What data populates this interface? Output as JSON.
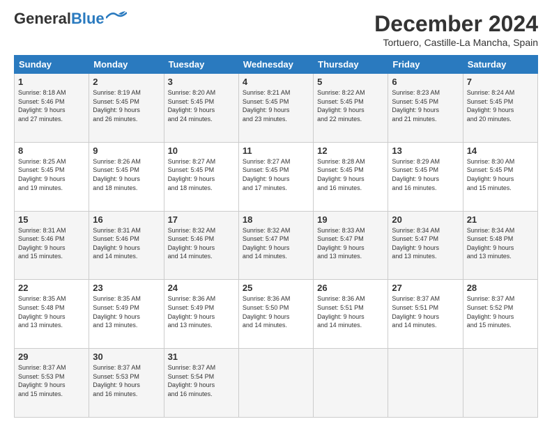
{
  "header": {
    "logo_line1": "General",
    "logo_line2": "Blue",
    "month": "December 2024",
    "location": "Tortuero, Castille-La Mancha, Spain"
  },
  "weekdays": [
    "Sunday",
    "Monday",
    "Tuesday",
    "Wednesday",
    "Thursday",
    "Friday",
    "Saturday"
  ],
  "weeks": [
    [
      {
        "day": "1",
        "info": "Sunrise: 8:18 AM\nSunset: 5:46 PM\nDaylight: 9 hours\nand 27 minutes."
      },
      {
        "day": "2",
        "info": "Sunrise: 8:19 AM\nSunset: 5:45 PM\nDaylight: 9 hours\nand 26 minutes."
      },
      {
        "day": "3",
        "info": "Sunrise: 8:20 AM\nSunset: 5:45 PM\nDaylight: 9 hours\nand 24 minutes."
      },
      {
        "day": "4",
        "info": "Sunrise: 8:21 AM\nSunset: 5:45 PM\nDaylight: 9 hours\nand 23 minutes."
      },
      {
        "day": "5",
        "info": "Sunrise: 8:22 AM\nSunset: 5:45 PM\nDaylight: 9 hours\nand 22 minutes."
      },
      {
        "day": "6",
        "info": "Sunrise: 8:23 AM\nSunset: 5:45 PM\nDaylight: 9 hours\nand 21 minutes."
      },
      {
        "day": "7",
        "info": "Sunrise: 8:24 AM\nSunset: 5:45 PM\nDaylight: 9 hours\nand 20 minutes."
      }
    ],
    [
      {
        "day": "8",
        "info": "Sunrise: 8:25 AM\nSunset: 5:45 PM\nDaylight: 9 hours\nand 19 minutes."
      },
      {
        "day": "9",
        "info": "Sunrise: 8:26 AM\nSunset: 5:45 PM\nDaylight: 9 hours\nand 18 minutes."
      },
      {
        "day": "10",
        "info": "Sunrise: 8:27 AM\nSunset: 5:45 PM\nDaylight: 9 hours\nand 18 minutes."
      },
      {
        "day": "11",
        "info": "Sunrise: 8:27 AM\nSunset: 5:45 PM\nDaylight: 9 hours\nand 17 minutes."
      },
      {
        "day": "12",
        "info": "Sunrise: 8:28 AM\nSunset: 5:45 PM\nDaylight: 9 hours\nand 16 minutes."
      },
      {
        "day": "13",
        "info": "Sunrise: 8:29 AM\nSunset: 5:45 PM\nDaylight: 9 hours\nand 16 minutes."
      },
      {
        "day": "14",
        "info": "Sunrise: 8:30 AM\nSunset: 5:45 PM\nDaylight: 9 hours\nand 15 minutes."
      }
    ],
    [
      {
        "day": "15",
        "info": "Sunrise: 8:31 AM\nSunset: 5:46 PM\nDaylight: 9 hours\nand 15 minutes."
      },
      {
        "day": "16",
        "info": "Sunrise: 8:31 AM\nSunset: 5:46 PM\nDaylight: 9 hours\nand 14 minutes."
      },
      {
        "day": "17",
        "info": "Sunrise: 8:32 AM\nSunset: 5:46 PM\nDaylight: 9 hours\nand 14 minutes."
      },
      {
        "day": "18",
        "info": "Sunrise: 8:32 AM\nSunset: 5:47 PM\nDaylight: 9 hours\nand 14 minutes."
      },
      {
        "day": "19",
        "info": "Sunrise: 8:33 AM\nSunset: 5:47 PM\nDaylight: 9 hours\nand 13 minutes."
      },
      {
        "day": "20",
        "info": "Sunrise: 8:34 AM\nSunset: 5:47 PM\nDaylight: 9 hours\nand 13 minutes."
      },
      {
        "day": "21",
        "info": "Sunrise: 8:34 AM\nSunset: 5:48 PM\nDaylight: 9 hours\nand 13 minutes."
      }
    ],
    [
      {
        "day": "22",
        "info": "Sunrise: 8:35 AM\nSunset: 5:48 PM\nDaylight: 9 hours\nand 13 minutes."
      },
      {
        "day": "23",
        "info": "Sunrise: 8:35 AM\nSunset: 5:49 PM\nDaylight: 9 hours\nand 13 minutes."
      },
      {
        "day": "24",
        "info": "Sunrise: 8:36 AM\nSunset: 5:49 PM\nDaylight: 9 hours\nand 13 minutes."
      },
      {
        "day": "25",
        "info": "Sunrise: 8:36 AM\nSunset: 5:50 PM\nDaylight: 9 hours\nand 14 minutes."
      },
      {
        "day": "26",
        "info": "Sunrise: 8:36 AM\nSunset: 5:51 PM\nDaylight: 9 hours\nand 14 minutes."
      },
      {
        "day": "27",
        "info": "Sunrise: 8:37 AM\nSunset: 5:51 PM\nDaylight: 9 hours\nand 14 minutes."
      },
      {
        "day": "28",
        "info": "Sunrise: 8:37 AM\nSunset: 5:52 PM\nDaylight: 9 hours\nand 15 minutes."
      }
    ],
    [
      {
        "day": "29",
        "info": "Sunrise: 8:37 AM\nSunset: 5:53 PM\nDaylight: 9 hours\nand 15 minutes."
      },
      {
        "day": "30",
        "info": "Sunrise: 8:37 AM\nSunset: 5:53 PM\nDaylight: 9 hours\nand 16 minutes."
      },
      {
        "day": "31",
        "info": "Sunrise: 8:37 AM\nSunset: 5:54 PM\nDaylight: 9 hours\nand 16 minutes."
      },
      null,
      null,
      null,
      null
    ]
  ]
}
